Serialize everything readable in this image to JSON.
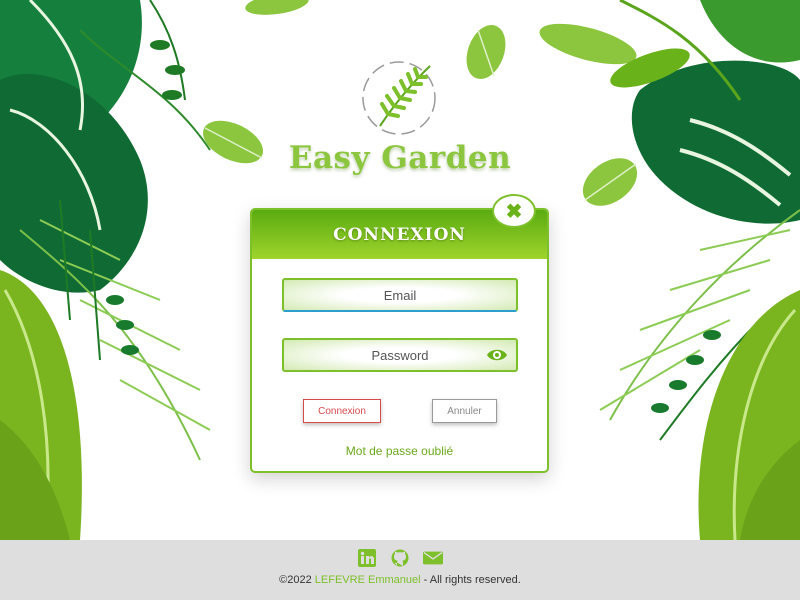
{
  "brand": {
    "name": "Easy Garden"
  },
  "login": {
    "title": "CONNEXION",
    "close_label": "✖",
    "email_placeholder": "Email",
    "password_placeholder": "Password",
    "submit_label": "Connexion",
    "cancel_label": "Annuler",
    "forgot_label": "Mot de passe oublié"
  },
  "icons": [
    "fern-logo-icon",
    "close-icon",
    "eye-icon",
    "linkedin-icon",
    "github-icon",
    "mail-icon"
  ],
  "footer": {
    "copyright_prefix": "©2022 ",
    "author": "LEFEVRE Emmanuel",
    "copyright_suffix": " - All rights reserved."
  },
  "colors": {
    "accent": "#7dc02b",
    "brand_text": "#8cc63f",
    "danger": "#d84b4b",
    "footer_bg": "#dedede"
  }
}
